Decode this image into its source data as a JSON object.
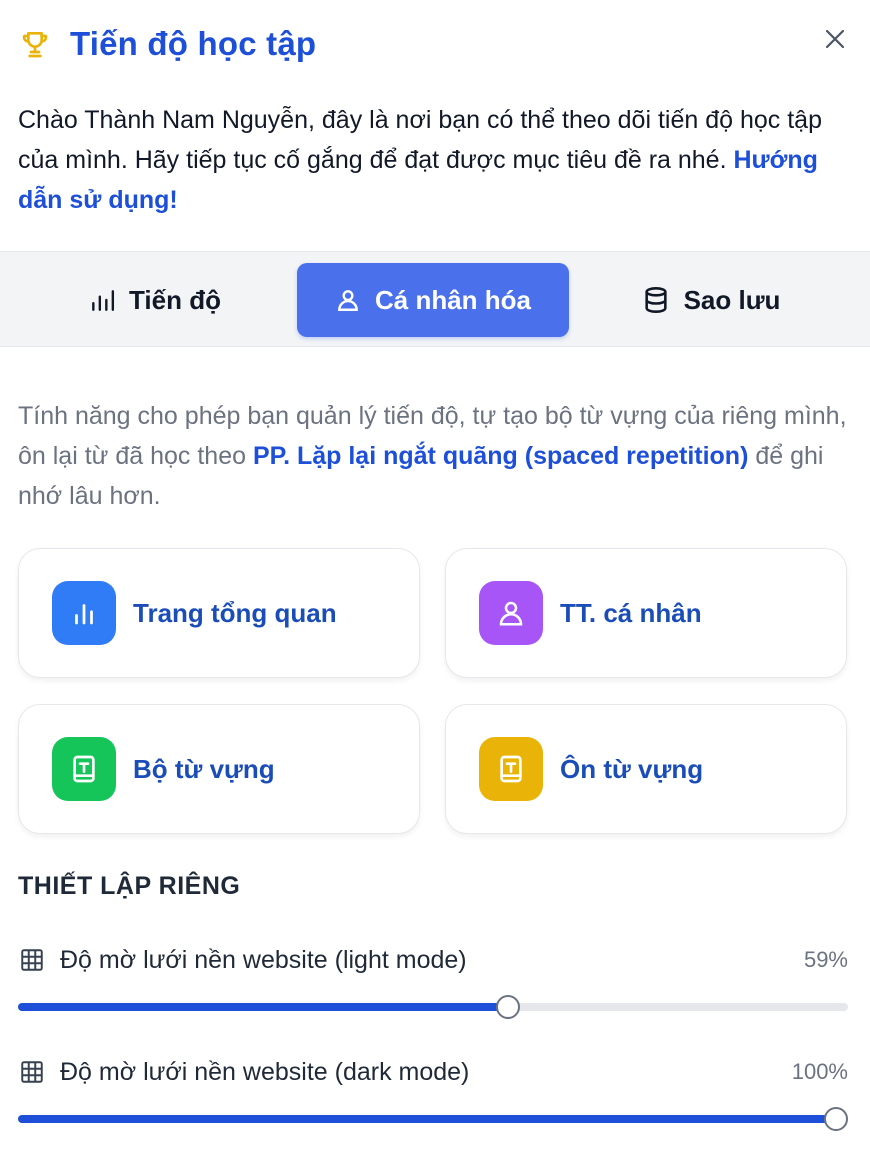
{
  "header": {
    "title": "Tiến độ học tập",
    "trophy_icon": "trophy-icon",
    "trophy_color": "#eab308",
    "close_icon": "close-icon"
  },
  "intro": {
    "text": "Chào Thành Nam Nguyễn, đây là nơi bạn có thể theo dõi tiến độ học tập của mình. Hãy tiếp tục cố gắng để đạt được mục tiêu đề ra nhé. ",
    "link": "Hướng dẫn sử dụng!"
  },
  "tabs": [
    {
      "label": "Tiến độ",
      "icon": "bar-chart-icon",
      "active": false
    },
    {
      "label": "Cá nhân hóa",
      "icon": "user-icon",
      "active": true
    },
    {
      "label": "Sao lưu",
      "icon": "database-icon",
      "active": false
    }
  ],
  "description": {
    "text_before": "Tính năng cho phép bạn quản lý tiến độ, tự tạo bộ từ vựng của riêng mình, ôn lại từ đã học theo ",
    "link": "PP. Lặp lại ngắt quãng (spaced repetition)",
    "text_after": " để ghi nhớ lâu hơn."
  },
  "cards": [
    {
      "label": "Trang tổng quan",
      "icon": "bar-chart-icon",
      "color": "#2f7cf6"
    },
    {
      "label": "TT. cá nhân",
      "icon": "user-icon",
      "color": "#a855f7"
    },
    {
      "label": "Bộ từ vựng",
      "icon": "book-icon",
      "color": "#16c55a"
    },
    {
      "label": "Ôn từ vựng",
      "icon": "book-icon",
      "color": "#eab308"
    }
  ],
  "settings": {
    "title": "THIẾT LẬP RIÊNG",
    "items": [
      {
        "label": "Độ mờ lưới nền website (light mode)",
        "value_text": "59%",
        "value": 59,
        "icon": "grid-icon"
      },
      {
        "label": "Độ mờ lưới nền website (dark mode)",
        "value_text": "100%",
        "value": 100,
        "icon": "grid-icon"
      }
    ]
  },
  "colors": {
    "accent": "#1d4fd8",
    "active_tab": "#4a70ec"
  }
}
